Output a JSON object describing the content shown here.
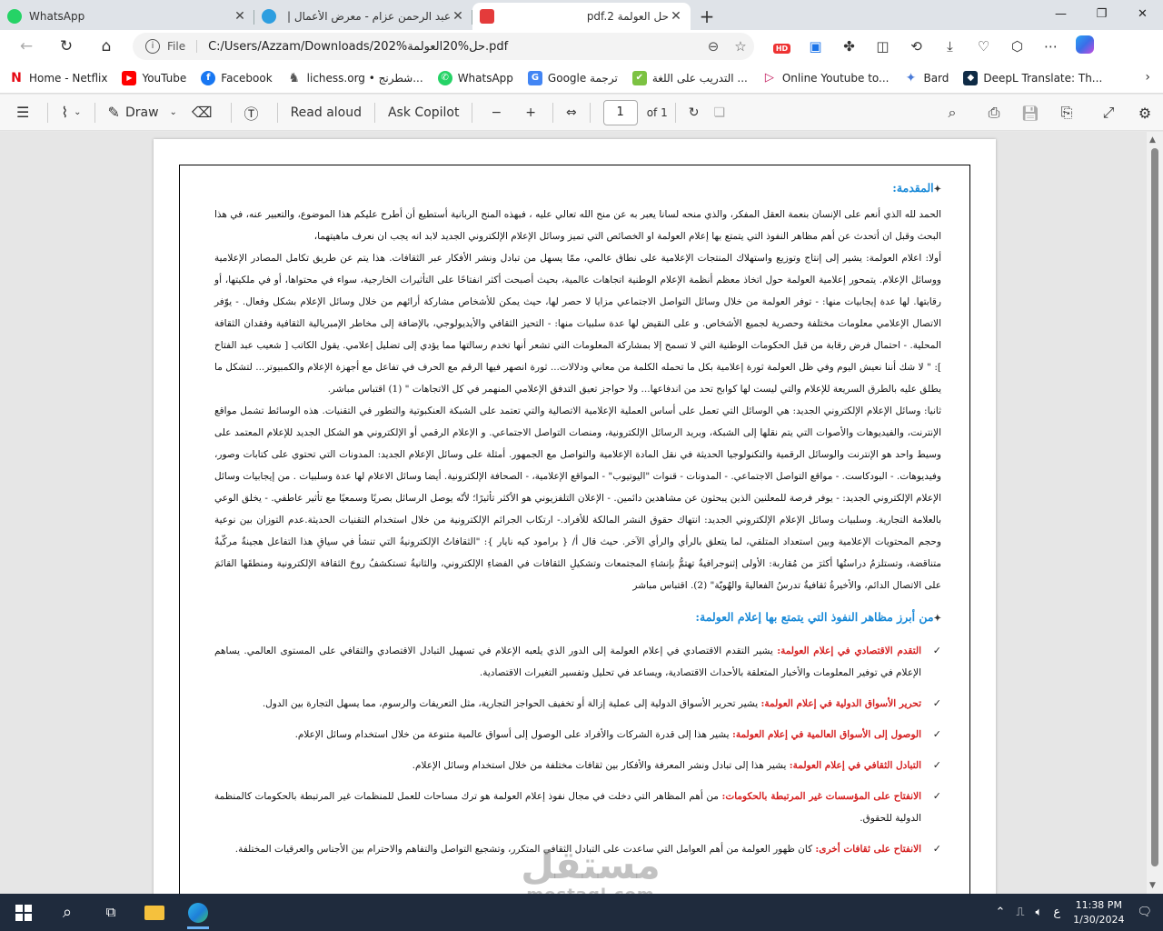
{
  "tabs": [
    {
      "title": "WhatsApp",
      "color": "#25d366"
    },
    {
      "title": "عبد الرحمن عزام - معرض الأعمال |",
      "color": "#2d9ee0"
    },
    {
      "title": "حل العولمة pdf.2",
      "color": "#e43b3b"
    }
  ],
  "address": {
    "scheme": "File",
    "url": "C:/Users/Azzam/Downloads/202%حل%20العولمة.pdf",
    "hd": "HD"
  },
  "bookmarks": [
    {
      "label": "Home - Netflix",
      "icon": "N",
      "color": "#e50914"
    },
    {
      "label": "YouTube",
      "icon": "▶",
      "color": "#ff0000"
    },
    {
      "label": "Facebook",
      "icon": "f",
      "color": "#1877f2"
    },
    {
      "label": "lichess.org • شطرنج...",
      "icon": "♞",
      "color": "#555555"
    },
    {
      "label": "WhatsApp",
      "icon": "✆",
      "color": "#25d366"
    },
    {
      "label": "Google ترجمة",
      "icon": "G",
      "color": "#4285f4"
    },
    {
      "label": "التدريب على اللغة ...",
      "icon": "✔",
      "color": "#7cc242"
    },
    {
      "label": "Online Youtube to...",
      "icon": "▷",
      "color": "#c2185b"
    },
    {
      "label": "Bard",
      "icon": "✦",
      "color": "#4a7bd8"
    },
    {
      "label": "DeepL Translate: Th...",
      "icon": "◆",
      "color": "#0f2b46"
    }
  ],
  "pdf_toolbar": {
    "draw": "Draw",
    "read_aloud": "Read aloud",
    "ask_copilot": "Ask Copilot",
    "page_current": "1",
    "page_total": "of 1"
  },
  "doc": {
    "heading1": "المقدمة:",
    "intro": "الحمد لله الذي أنعم على الإنسان بنعمة العقل المفكر، والذي منحه لسانا يعبر به عن منح الله تعالي عليه ، فبهذه المنح الربانية أستطيع أن أطرح عليكم هذا الموضوع، والتعبير عنه، في هذا البحث وقبل ان أتحدث عن أهم مظاهر النفوذ التي يتمتع بها إعلام العولمة او الخصائص التي تميز وسائل الإعلام الإلكتروني الجديد لابد انه يجب ان نعرف ماهيتهما،",
    "p1": "أولا: اعلام العولمة: يشير إلى إنتاج وتوزيع واستهلاك المنتجات الإعلامية على نطاق عالمي، ممّا يسهل من تبادل ونشر الأفكار عبر الثقافات. هذا يتم عن طريق تكامل المصادر الإعلامية ووسائل الإعلام. يتمحور إعلامية العولمة حول اتخاذ معظم أنظمة الإعلام الوطنية اتجاهات عالمية، بحيث أصبحت أكثر انفتاحًا على التأثيرات الخارجية، سواء في محتواها، أو في ملكيتها، أو رقابتها. لها عدة إيجابيات منها: - توفر العولمة من خلال وسائل التواصل الاجتماعي مزايا لا حصر لها، حيث يمكن للأشخاص مشاركة أرائهم من خلال وسائل الإعلام بشكل وفعال. - يوّفر الاتصال الإعلامي معلومات مختلفة وحصرية لجميع الأشخاص. و على النقيض لها عدة سلبيات منها: - التحيز الثقافي والأيديولوجي، بالإضافة إلى مخاطر الإمبريالية الثقافية وفقدان الثقافة المحلية. - احتمال فرض رقابة من قبل الحكومات الوطنية التي لا تسمح إلا بمشاركة المعلومات التي تشعر أنها تخدم رسالتها مما يؤدي إلى تضليل إعلامي. يقول الكاتب [ شعيب عبد الفتاح ]: \" لا شك أننا نعيش اليوم وفي ظل العولمة ثورة إعلامية بكل ما تحمله الكلمة من معاني ودلالات... ثورة انصهر فيها الرقم مع الحرف في تفاعل مع أجهزة الإعلام والكمبيوتر... لتشكل ما يطلق عليه بالطرق السريعة للإعلام والتي ليست لها كوابح تحد من اندفاعها... ولا حواجز تعيق التدفق الإعلامي المنهمر في كل الاتجاهات \" (1) اقتباس مباشر.",
    "p2": "ثانيا: وسائل الإعلام الإلكتروني الجديد: هي الوسائل التي تعمل على أساس العملية الإعلامية الاتصالية والتي تعتمد على الشبكة العنكبوتية والتطور في التقنيات. هذه الوسائط تشمل مواقع الإنترنت، والفيديوهات والأصوات التي يتم نقلها إلى الشبكة، وبريد الرسائل الإلكترونية، ومنصات التواصل الاجتماعي. و الإعلام الرقمي أو الإلكتروني هو الشكل الجديد للإعلام المعتمد على وسيط واحد هو الإنترنت والوسائل الرقمية والتكنولوجيا الحديثة في نقل المادة الإعلامية والتواصل مع الجمهور. أمثلة على وسائل الإعلام الجديد: المدونات التي تحتوي على كتابات وصور، وفيديوهات. - البودكاست. - مواقع التواصل الاجتماعي. - المدونات - قنوات \"اليوتيوب\" - المواقع الإعلامية، - الصحافة الإلكترونية. أيضا وسائل الاعلام لها عدة وسلبيات . من إيجابيات وسائل الإعلام الإلكتروني الجديد: - يوفر فرصة للمعلنين الذين يبحثون عن مشاهدين دائمين. - الإعلان التلفزيوني هو الأكثر تأثيرًا؛ لأنّه يوصل الرسائل بصريًا وسمعيًا مع تأثير عاطفي. - يخلق الوعي بالعلامة التجارية. وسلبيات وسائل الإعلام الإلكتروني الجديد: انتهاك حقوق النشر المالكة للأفراد.- ارتكاب الجرائم الإلكترونية من خلال استخدام التقنيات الحديثة.عدم التوزان بين نوعية وحجم المحتويات الإعلامية وبين استعداد المتلقي، لما يتعلق بالرأي والرأي الآخر. حيث قال أ/ { برامود كيه نايار }: \"الثقافاتُ الإلكترونيةُ التي تنشأ في سياقِ هذا التفاعل هجينةٌ مركّبةٌ متناقضة، وتستلزمُ دراستُها أكثرَ من مُقاربة: الأولى إثنوجرافيةٌ تهتمُّ بإنشاءِ المجتمعات وتشكيلِ الثقافات في الفضاءِ الإلكتروني، والثانيةُ تستكشفُ روحَ الثقافة الإلكترونية ومنطقَها القائمَ على الاتصال الدائم، والأخيرةُ ثقافيةٌ تدرسُ الفعاليةَ والهُويّة\" (2). اقتباس مباشر",
    "heading2": "من أبرز مظاهر النفوذ التي يتمتع بها إعلام العولمة:",
    "items": [
      {
        "label": "التقدم الاقتصادي في إعلام العولمة:",
        "text": " يشير التقدم الاقتصادي في إعلام العولمة إلى الدور الذي يلعبه الإعلام في تسهيل التبادل الاقتصادي والثقافي على المستوى العالمي. يساهم الإعلام في توفير المعلومات والأخبار المتعلقة بالأحداث الاقتصادية، ويساعد في تحليل وتفسير التغيرات الاقتصادية."
      },
      {
        "label": "تحرير الأسواق الدولية في إعلام العولمة:",
        "text": " يشير تحرير الأسواق الدولية إلى عملية إزالة أو تخفيف الحواجز التجارية، مثل التعريفات والرسوم، مما يسهل التجارة بين الدول."
      },
      {
        "label": "الوصول إلى الأسواق العالمية في إعلام العولمة:",
        "text": " يشير هذا إلى قدرة الشركات والأفراد على الوصول إلى أسواق عالمية متنوعة من خلال استخدام وسائل الإعلام."
      },
      {
        "label": "التبادل الثقافي في إعلام العولمة:",
        "text": " يشير هذا إلى تبادل ونشر المعرفة والأفكار بين ثقافات مختلفة من خلال استخدام وسائل الإعلام."
      },
      {
        "label": "الانفتاح على المؤسسات غير المرتبطة بالحكومات:",
        "text": " من أهم المظاهر التي دخلت في مجال نفوذ إعلام العولمة هو ترك مساحات للعمل للمنظمات غير المرتبطة بالحكومات كالمنظمة الدولية للحقوق."
      },
      {
        "label": "الانفتاح على ثقافات أخرى:",
        "text": " كان ظهور العولمة من أهم العوامل التي ساعدت على التبادل الثقافي المتكرر، وتشجيع التواصل والتفاهم والاحترام بين الأجناس والعرقيات المختلفة."
      }
    ]
  },
  "watermark": {
    "arabic": "مستقل",
    "latin": "mostaql.com"
  },
  "taskbar": {
    "time": "11:38 PM",
    "date": "1/30/2024",
    "lang": "ع"
  }
}
